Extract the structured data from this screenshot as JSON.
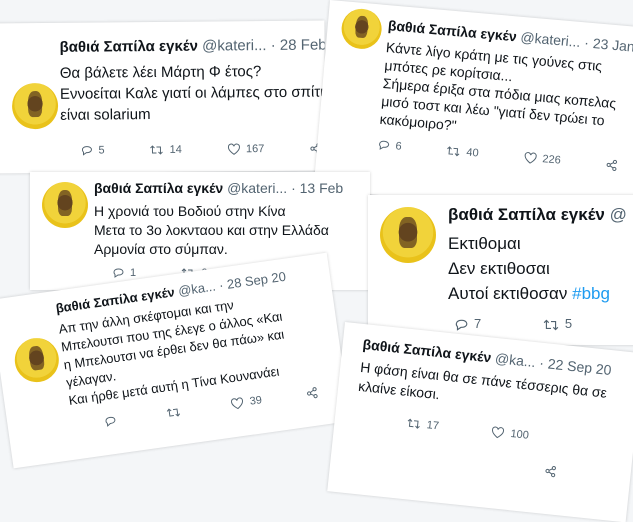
{
  "tweets": [
    {
      "name": "βαθιά Σαπίλα εγκέν",
      "handle": "@kateri...",
      "date": "· 28 Feb",
      "lines": [
        "Θα βάλετε λέει Μάρτη Φ έτος?",
        "Εννοείται Καλε γιατί οι λάμπες στο σπίτι",
        "είναι solarium"
      ],
      "replies": "5",
      "retweets": "14",
      "likes": "167"
    },
    {
      "name": "βαθιά Σαπίλα εγκέν",
      "handle": "@kateri...",
      "date": "· 23 Jan",
      "lines": [
        "Κάντε λίγο κράτη με τις γούνες στις",
        "μπότες ρε κορίτσια...",
        "Σήμερα έριξα στα πόδια μιας κοπελας",
        "μισό τοστ και λέω \"γιατί δεν τρώει το",
        "κακόμοιρο?\""
      ],
      "replies": "6",
      "retweets": "40",
      "likes": "226"
    },
    {
      "name": "βαθιά Σαπίλα εγκέν",
      "handle": "@kateri...",
      "date": "· 13 Feb",
      "lines": [
        "Η χρονιά του Βοδιού στην Κίνα",
        "Μετα το 3ο λοκνταου και στην Ελλάδα",
        "Αρμονία στο σύμπαν."
      ],
      "replies": "1",
      "retweets": "6",
      "likes": ""
    },
    {
      "name": "βαθιά Σαπίλα εγκέν",
      "handle": "@ka...",
      "date": "· 28 Sep 20",
      "lines": [
        "Απ την άλλη σκέφτομαι και την",
        "Μπελουτσι που της έλεγε ο άλλος «Και",
        "η Μπελουτσι να έρθει δεν θα πάω» και",
        "γέλαγαν.",
        "Και ήρθε μετά αυτή η Τίνα Κουνανάει"
      ],
      "replies": "",
      "retweets": "",
      "likes": "39"
    },
    {
      "name": "βαθιά Σαπίλα εγκέν",
      "handle": "@",
      "date": "",
      "lines": [
        "Εκτιθομαι",
        "Δεν εκτιθοσαι",
        "Αυτοί εκτιθοσαν"
      ],
      "hashtag": "#bbg",
      "replies": "7",
      "retweets": "5",
      "likes": ""
    },
    {
      "name": "βαθιά Σαπίλα εγκέν",
      "handle": "@ka...",
      "date": "· 22 Sep 20",
      "lines": [
        "Η φάση είναι θα σε πάνε τέσσερις θα σε",
        "κλαίνε είκοσι."
      ],
      "replies": "",
      "retweets": "17",
      "likes": "100"
    }
  ]
}
